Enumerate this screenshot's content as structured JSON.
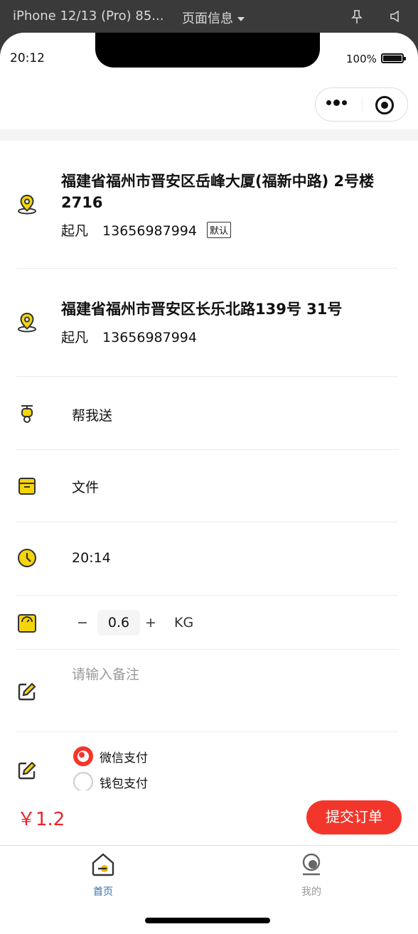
{
  "devtools": {
    "device": "iPhone 12/13 (Pro) 85...",
    "page_info": "页面信息"
  },
  "status_bar": {
    "time": "20:12",
    "battery": "100%"
  },
  "colors": {
    "accent": "#f3362b",
    "price": "#e8262c",
    "icon_yellow": "#f5d50a"
  },
  "addresses": [
    {
      "address": "福建省福州市晋安区岳峰大厦(福新中路) 2号楼2716",
      "name": "起凡",
      "phone": "13656987994",
      "badge": "默认",
      "icon": "location-pin-icon"
    },
    {
      "address": "福建省福州市晋安区长乐北路139号 31号",
      "name": "起凡",
      "phone": "13656987994",
      "icon": "location-pin-icon"
    }
  ],
  "service": {
    "label": "帮我送",
    "icon": "scooter-icon"
  },
  "item_type": {
    "label": "文件",
    "icon": "box-icon"
  },
  "delivery_time": {
    "label": "20:14",
    "icon": "clock-icon"
  },
  "weight": {
    "minus": "−",
    "value": "0.6",
    "plus": "+",
    "unit": "KG",
    "icon": "scale-icon"
  },
  "remark": {
    "placeholder": "请输入备注",
    "icon": "edit-icon"
  },
  "payment": {
    "icon": "edit-icon",
    "options": [
      {
        "label": "微信支付",
        "selected": true
      },
      {
        "label": "钱包支付",
        "selected": false
      }
    ]
  },
  "footer": {
    "price": "￥1.2",
    "submit_label": "提交订单"
  },
  "tabbar": {
    "items": [
      {
        "label": "首页",
        "active": true,
        "icon": "home-icon"
      },
      {
        "label": "我的",
        "active": false,
        "icon": "profile-icon"
      }
    ]
  }
}
